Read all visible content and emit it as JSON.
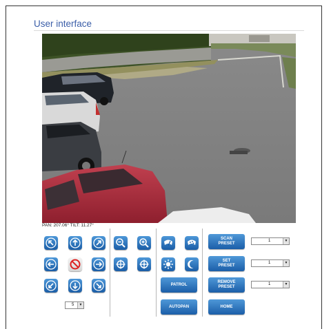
{
  "page": {
    "title": "User interface"
  },
  "status": {
    "pan_tilt": "PAN: 207.06° TILT: 11.27°"
  },
  "speed_select": {
    "value": "5"
  },
  "buttons": {
    "patrol": "PATROL",
    "autopan": "AUTOPAN",
    "scan_preset": "SCAN\nPRESET",
    "set_preset": "SET\nPRESET",
    "remove_preset": "REMOVE\nPRESET",
    "home": "HOME"
  },
  "preset_selects": {
    "scan": "1",
    "set": "1",
    "remove": "1"
  }
}
